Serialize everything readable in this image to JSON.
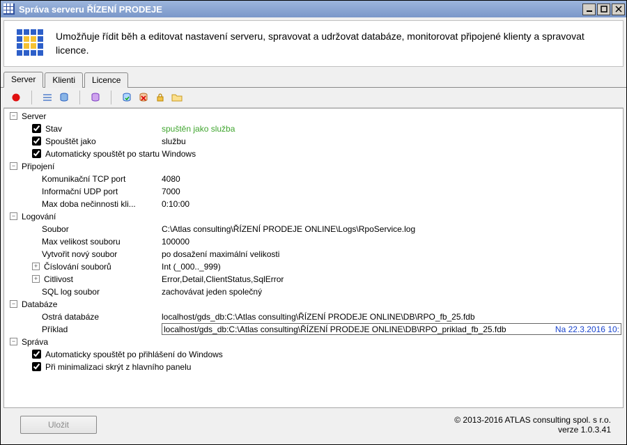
{
  "window_title": "Správa serveru ŘÍZENÍ PRODEJE",
  "info_description": "Umožňuje řídit běh a editovat nastavení serveru, spravovat a udržovat databáze, monitorovat připojené klienty a spravovat licence.",
  "tabs": {
    "server": "Server",
    "klienti": "Klienti",
    "licence": "Licence"
  },
  "groups": {
    "server": {
      "label": "Server",
      "stav_label": "Stav",
      "stav_value": "spuštěn jako služba",
      "spoustet_label": "Spouštět jako",
      "spoustet_value": "službu",
      "autostart_label": "Automaticky spouštět po startu Windows"
    },
    "pripojeni": {
      "label": "Připojení",
      "tcp_label": "Komunikační TCP port",
      "tcp_value": "4080",
      "udp_label": "Informační UDP port",
      "udp_value": "7000",
      "idle_label": "Max doba nečinnosti kli...",
      "idle_value": "0:10:00"
    },
    "logovani": {
      "label": "Logování",
      "soubor_label": "Soubor",
      "soubor_value": "C:\\Atlas consulting\\ŘÍZENÍ PRODEJE ONLINE\\Logs\\RpoService.log",
      "maxvel_label": "Max velikost souboru",
      "maxvel_value": "100000",
      "novy_label": "Vytvořit nový soubor",
      "novy_value": "po dosažení maximální velikosti",
      "cislovani_label": "Číslování souborů",
      "cislovani_value": "Int (_000.._999)",
      "citlivost_label": "Citlivost",
      "citlivost_value": "Error,Detail,ClientStatus,SqlError",
      "sqllog_label": "SQL log soubor",
      "sqllog_value": "zachovávat jeden společný"
    },
    "databaze": {
      "label": "Databáze",
      "ostra_label": "Ostrá databáze",
      "ostra_value": "localhost/gds_db:C:\\Atlas consulting\\ŘÍZENÍ PRODEJE ONLINE\\DB\\RPO_fb_25.fdb",
      "priklad_label": "Příklad",
      "priklad_value": "localhost/gds_db:C:\\Atlas consulting\\ŘÍZENÍ PRODEJE ONLINE\\DB\\RPO_priklad_fb_25.fdb",
      "priklad_meta": "Na 22.3.2016 10:"
    },
    "sprava": {
      "label": "Správa",
      "autostart_login_label": "Automaticky spouštět po přihlášení do Windows",
      "minimize_hide_label": "Při minimalizaci skrýt z hlavního panelu"
    }
  },
  "footer": {
    "save_label": "Uložit",
    "copyright": "© 2013-2016  ATLAS consulting spol. s r.o.",
    "version": "verze 1.0.3.41"
  }
}
